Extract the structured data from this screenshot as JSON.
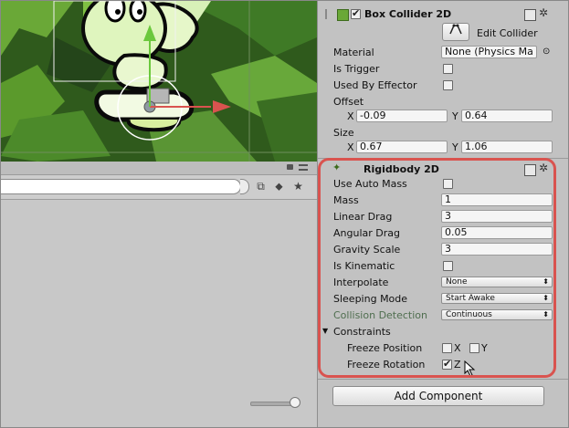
{
  "box_collider": {
    "title": "Box Collider 2D",
    "enabled": true,
    "edit_collider_label": "Edit Collider",
    "material_label": "Material",
    "material_value": "None (Physics Ma",
    "is_trigger_label": "Is Trigger",
    "is_trigger": false,
    "used_by_effector_label": "Used By Effector",
    "used_by_effector": false,
    "offset_label": "Offset",
    "offset_x_label": "X",
    "offset_x": "-0.09",
    "offset_y_label": "Y",
    "offset_y": "0.64",
    "size_label": "Size",
    "size_x_label": "X",
    "size_x": "0.67",
    "size_y_label": "Y",
    "size_y": "1.06"
  },
  "rigidbody": {
    "title": "Rigidbody 2D",
    "use_auto_mass_label": "Use Auto Mass",
    "use_auto_mass": false,
    "mass_label": "Mass",
    "mass": "1",
    "linear_drag_label": "Linear Drag",
    "linear_drag": "3",
    "angular_drag_label": "Angular Drag",
    "angular_drag": "0.05",
    "gravity_scale_label": "Gravity Scale",
    "gravity_scale": "3",
    "is_kinematic_label": "Is Kinematic",
    "is_kinematic": false,
    "interpolate_label": "Interpolate",
    "interpolate": "None",
    "sleeping_mode_label": "Sleeping Mode",
    "sleeping_mode": "Start Awake",
    "collision_detection_label": "Collision Detection",
    "collision_detection": "Continuous",
    "constraints_label": "Constraints",
    "freeze_position_label": "Freeze Position",
    "freeze_position_x_label": "X",
    "freeze_position_x": false,
    "freeze_position_y_label": "Y",
    "freeze_position_y": false,
    "freeze_rotation_label": "Freeze Rotation",
    "freeze_rotation_z_label": "Z",
    "freeze_rotation_z": true
  },
  "add_component_label": "Add Component",
  "colors": {
    "highlight": "#d9534f",
    "collision_label": "#4f6e4f",
    "scene_bg": "#2f5a1c"
  },
  "icons": [
    "settings-gear-icon",
    "help-book-icon",
    "edit-collider-icon",
    "lock-icon",
    "panel-menu-icon",
    "filter-type-icon",
    "label-tag-icon",
    "favorite-star-icon",
    "mouse-cursor-icon",
    "physics-body-icon"
  ]
}
